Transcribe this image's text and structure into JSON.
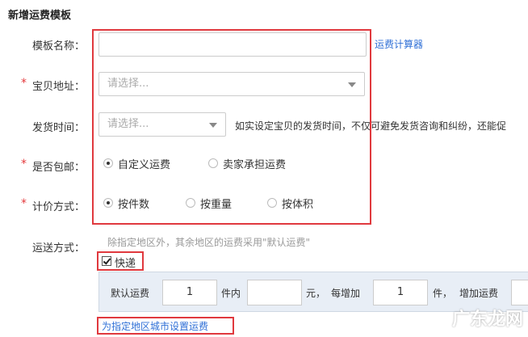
{
  "section_title": "新增运费模板",
  "template_name": {
    "label": "模板名称：",
    "value": "",
    "link": "运费计算器"
  },
  "ship_from": {
    "label": "宝贝地址：",
    "placeholder": "请选择..."
  },
  "ship_time": {
    "label": "发货时间：",
    "placeholder": "请选择...",
    "hint": "如实设定宝贝的发货时间，不仅可避免发货咨询和纠纷，还能促"
  },
  "free_shipping": {
    "label": "是否包邮：",
    "options": [
      {
        "label": "自定义运费",
        "checked": true
      },
      {
        "label": "卖家承担运费",
        "checked": false
      }
    ]
  },
  "pricing": {
    "label": "计价方式：",
    "options": [
      {
        "label": "按件数",
        "checked": true
      },
      {
        "label": "按重量",
        "checked": false
      },
      {
        "label": "按体积",
        "checked": false
      }
    ]
  },
  "delivery": {
    "label": "运送方式：",
    "hint": "除指定地区外，其余地区的运费采用\"默认运费\"",
    "express_label": "快递",
    "express_checked": true,
    "default_fee_label": "默认运费",
    "first_count": "1",
    "first_unit": "件内",
    "first_fee": "",
    "fee_unit": "元，",
    "each_add_label": "每增加",
    "add_count": "1",
    "add_unit": "件，",
    "add_fee_label": "增加运费",
    "add_fee": "",
    "set_region_link": "为指定地区城市设置运费"
  },
  "watermark": "广东龙网",
  "colors": {
    "highlight_red": "#e0393e",
    "link_blue": "#2f6fd6",
    "required_red": "#e4393c"
  }
}
